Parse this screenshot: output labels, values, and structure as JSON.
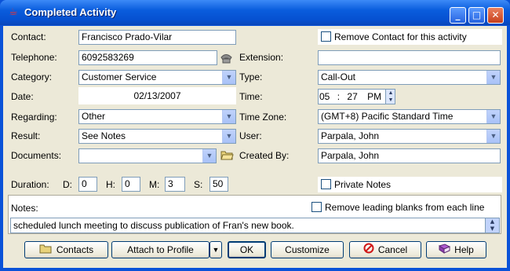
{
  "window": {
    "title": "Completed Activity"
  },
  "contact": {
    "label": "Contact:",
    "value": "Francisco Prado-Vilar"
  },
  "remove_contact": {
    "label": "Remove Contact for this activity",
    "checked": false
  },
  "telephone": {
    "label": "Telephone:",
    "value": "6092583269"
  },
  "extension": {
    "label": "Extension:",
    "value": ""
  },
  "category": {
    "label": "Category:",
    "value": "Customer Service"
  },
  "type": {
    "label": "Type:",
    "value": "Call-Out"
  },
  "date": {
    "label": "Date:",
    "value": "02/13/2007"
  },
  "time": {
    "label": "Time:",
    "hour": "05",
    "sep": ":",
    "minute": "27",
    "ampm": "PM"
  },
  "regarding": {
    "label": "Regarding:",
    "value": "Other"
  },
  "timezone": {
    "label": "Time Zone:",
    "value": "(GMT+8) Pacific Standard Time"
  },
  "result": {
    "label": "Result:",
    "value": "See Notes"
  },
  "user": {
    "label": "User:",
    "value": "Parpala, John"
  },
  "documents": {
    "label": "Documents:",
    "value": ""
  },
  "created_by": {
    "label": "Created By:",
    "value": "Parpala, John"
  },
  "duration": {
    "label": "Duration:",
    "d_label": "D:",
    "d": "0",
    "h_label": "H:",
    "h": "0",
    "m_label": "M:",
    "m": "3",
    "s_label": "S:",
    "s": "50"
  },
  "private_notes": {
    "label": "Private Notes",
    "checked": false
  },
  "notes": {
    "label": "Notes:",
    "value": "scheduled lunch meeting to discuss publication of Fran's new book."
  },
  "remove_blanks": {
    "label": "Remove leading blanks from each line",
    "checked": false
  },
  "buttons": {
    "contacts": "Contacts",
    "attach": "Attach to Profile",
    "ok": "OK",
    "customize": "Customize",
    "cancel": "Cancel",
    "help": "Help"
  },
  "icons": [
    "coffee-cup-icon",
    "phone-icon",
    "dropdown-arrow-icon",
    "folder-icon",
    "cancel-icon",
    "help-book-icon"
  ]
}
